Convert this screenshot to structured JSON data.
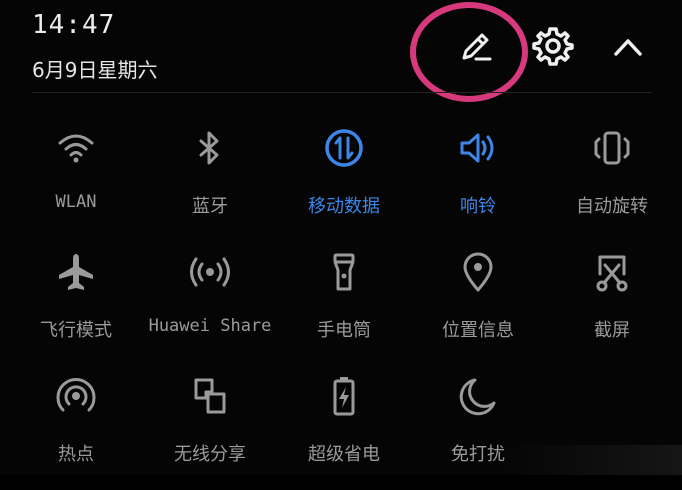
{
  "status": {
    "time": "14:47",
    "date": "6月9日星期六"
  },
  "header": {
    "edit_icon": "pencil-icon",
    "settings_icon": "gear-icon",
    "collapse_icon": "chevron-up-icon",
    "highlight_color": "#d63a7c"
  },
  "colors": {
    "active": "#3d86e8",
    "inactive": "#9a9a9a",
    "background": "#050505"
  },
  "tiles": [
    {
      "label": "WLAN",
      "icon": "wifi-icon",
      "active": false
    },
    {
      "label": "蓝牙",
      "icon": "bluetooth-icon",
      "active": false
    },
    {
      "label": "移动数据",
      "icon": "mobile-data-icon",
      "active": true
    },
    {
      "label": "响铃",
      "icon": "speaker-icon",
      "active": true
    },
    {
      "label": "自动旋转",
      "icon": "auto-rotate-icon",
      "active": false
    },
    {
      "label": "飞行模式",
      "icon": "airplane-icon",
      "active": false
    },
    {
      "label": "Huawei Share",
      "icon": "huawei-share-icon",
      "active": false
    },
    {
      "label": "手电筒",
      "icon": "flashlight-icon",
      "active": false
    },
    {
      "label": "位置信息",
      "icon": "location-pin-icon",
      "active": false
    },
    {
      "label": "截屏",
      "icon": "screenshot-icon",
      "active": false
    },
    {
      "label": "热点",
      "icon": "hotspot-icon",
      "active": false
    },
    {
      "label": "无线分享",
      "icon": "wireless-share-icon",
      "active": false
    },
    {
      "label": "超级省电",
      "icon": "battery-saver-icon",
      "active": false
    },
    {
      "label": "免打扰",
      "icon": "moon-icon",
      "active": false
    }
  ]
}
